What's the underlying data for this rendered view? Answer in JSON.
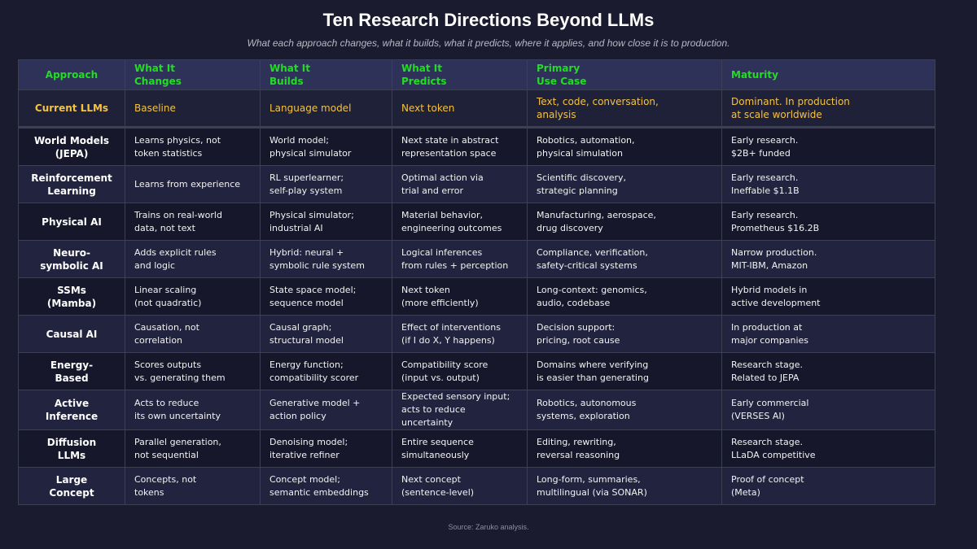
{
  "page": {
    "title": "Ten Research Directions Beyond LLMs",
    "subtitle": "What each approach changes, what it builds, what it predicts, where it applies, and how close it is to production.",
    "source": "Source: Zaruko analysis."
  },
  "colors": {
    "background": "#1a1b2e",
    "header_background": "#2e3158",
    "header_text": "#22dd22",
    "baseline_text": "#f5c242",
    "body_text": "#f2f2f2"
  },
  "table": {
    "headers": [
      "Approach",
      "What It\nChanges",
      "What It\nBuilds",
      "What It\nPredicts",
      "Primary\nUse Case",
      "Maturity"
    ],
    "baseline": [
      "Current LLMs",
      "Baseline",
      "Language model",
      "Next token",
      "Text, code, conversation,\nanalysis",
      "Dominant. In production\nat scale worldwide"
    ],
    "rows": [
      [
        "World Models\n(JEPA)",
        "Learns physics, not\ntoken statistics",
        "World model;\nphysical simulator",
        "Next state in abstract\nrepresentation space",
        "Robotics, automation,\nphysical simulation",
        "Early research.\n$2B+ funded"
      ],
      [
        "Reinforcement\nLearning",
        "Learns from experience",
        "RL superlearner;\nself-play system",
        "Optimal action via\ntrial and error",
        "Scientific discovery,\nstrategic planning",
        "Early research.\nIneffable $1.1B"
      ],
      [
        "Physical AI",
        "Trains on real-world\ndata, not text",
        "Physical simulator;\nindustrial AI",
        "Material behavior,\nengineering outcomes",
        "Manufacturing, aerospace,\ndrug discovery",
        "Early research.\nPrometheus $16.2B"
      ],
      [
        "Neuro-\nsymbolic AI",
        "Adds explicit rules\nand logic",
        "Hybrid: neural +\nsymbolic rule system",
        "Logical inferences\nfrom rules + perception",
        "Compliance, verification,\nsafety-critical systems",
        "Narrow production.\nMIT-IBM, Amazon"
      ],
      [
        "SSMs\n(Mamba)",
        "Linear scaling\n(not quadratic)",
        "State space model;\nsequence model",
        "Next token\n(more efficiently)",
        "Long-context: genomics,\naudio, codebase",
        "Hybrid models in\nactive development"
      ],
      [
        "Causal AI",
        "Causation, not\ncorrelation",
        "Causal graph;\nstructural model",
        "Effect of interventions\n(if I do X, Y happens)",
        "Decision support:\npricing, root cause",
        "In production at\nmajor companies"
      ],
      [
        "Energy-\nBased",
        "Scores outputs\nvs. generating them",
        "Energy function;\ncompatibility scorer",
        "Compatibility score\n(input vs. output)",
        "Domains where verifying\nis easier than generating",
        "Research stage.\nRelated to JEPA"
      ],
      [
        "Active\nInference",
        "Acts to reduce\nits own uncertainty",
        "Generative model +\naction policy",
        "Expected sensory input;\nacts to reduce uncertainty",
        "Robotics, autonomous\nsystems, exploration",
        "Early commercial\n(VERSES AI)"
      ],
      [
        "Diffusion\nLLMs",
        "Parallel generation,\nnot sequential",
        "Denoising model;\niterative refiner",
        "Entire sequence\nsimultaneously",
        "Editing, rewriting,\nreversal reasoning",
        "Research stage.\nLLaDA competitive"
      ],
      [
        "Large\nConcept",
        "Concepts, not\ntokens",
        "Concept model;\nsemantic embeddings",
        "Next concept\n(sentence-level)",
        "Long-form, summaries,\nmultilingual (via SONAR)",
        "Proof of concept\n(Meta)"
      ]
    ]
  }
}
